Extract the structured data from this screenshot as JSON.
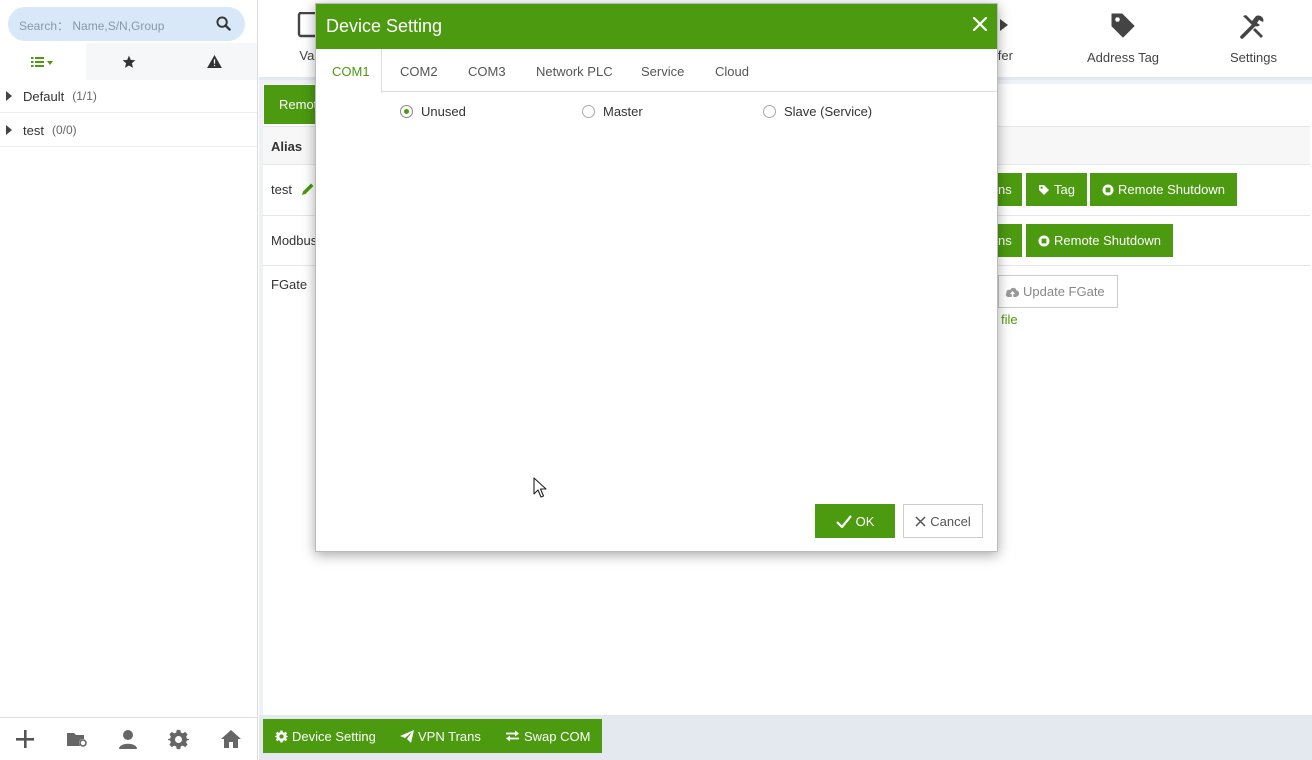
{
  "search": {
    "placeholder": "Search： Name,S/N,Group"
  },
  "sidebar": {
    "tabs": [
      {
        "icon": "list-dropdown-icon"
      },
      {
        "icon": "star-icon"
      },
      {
        "icon": "warning-icon"
      }
    ],
    "tree": [
      {
        "name": "Default",
        "count": "(1/1)"
      },
      {
        "name": "test",
        "count": "(0/0)"
      }
    ],
    "bottom_icons": [
      "add-icon",
      "folder-settings-icon",
      "user-icon",
      "gear-icon",
      "home-icon"
    ]
  },
  "toolbar": {
    "items": [
      {
        "label": "Var",
        "icon": "variable-icon"
      },
      {
        "label": "nsfer",
        "icon": "transfer-icon"
      },
      {
        "label": "Address Tag",
        "icon": "tag-icon"
      },
      {
        "label": "Settings",
        "icon": "tools-icon"
      }
    ]
  },
  "content": {
    "active_tab": "Remote",
    "table_header_alias": "Alias",
    "rows": [
      {
        "alias": "test",
        "buttons": [
          "ns",
          "Tag",
          "Remote Shutdown"
        ]
      },
      {
        "alias": "Modbus",
        "buttons": [
          "ns",
          "Remote Shutdown"
        ]
      },
      {
        "alias": "FGate",
        "update_button": "Update FGate",
        "link": "file"
      }
    ]
  },
  "bottom_bar": {
    "device_setting": "Device Setting",
    "vpn_trans": "VPN Trans",
    "swap_com": "Swap COM"
  },
  "dialog": {
    "title": "Device Setting",
    "tabs": [
      "COM1",
      "COM2",
      "COM3",
      "Network PLC",
      "Service",
      "Cloud"
    ],
    "active_tab": "COM1",
    "radio_options": [
      "Unused",
      "Master",
      "Slave (Service)"
    ],
    "selected_option": "Unused",
    "ok_label": "OK",
    "cancel_label": "Cancel"
  },
  "colors": {
    "accent": "#4c9a10",
    "search_bg": "#d9e8f8",
    "content_bg": "#eef2f6"
  }
}
